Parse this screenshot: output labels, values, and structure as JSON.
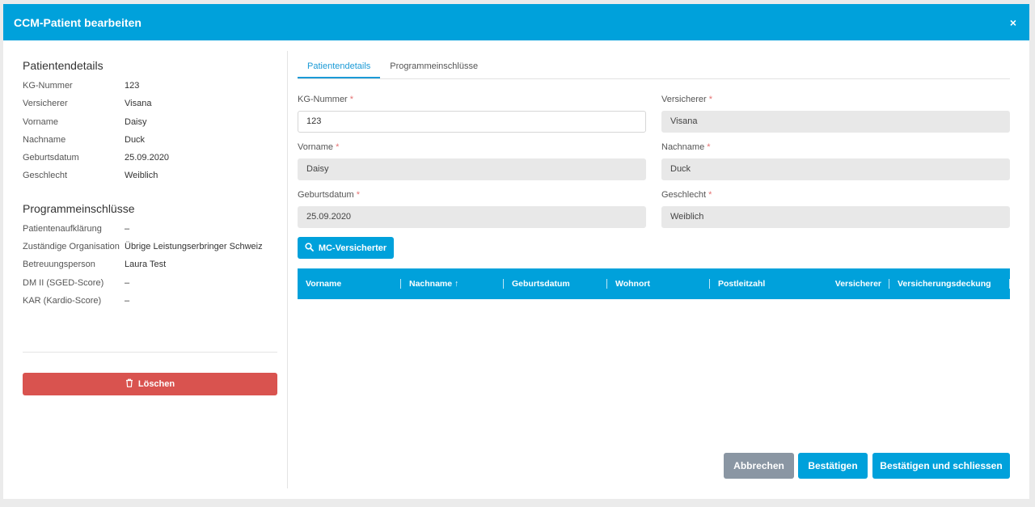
{
  "dialog": {
    "title": "CCM-Patient bearbeiten",
    "close_glyph": "×"
  },
  "patient_details": {
    "title": "Patientendetails",
    "rows": [
      {
        "key": "KG-Nummer",
        "value": "123"
      },
      {
        "key": "Versicherer",
        "value": "Visana"
      },
      {
        "key": "Vorname",
        "value": "Daisy"
      },
      {
        "key": "Nachname",
        "value": "Duck"
      },
      {
        "key": "Geburtsdatum",
        "value": "25.09.2020"
      },
      {
        "key": "Geschlecht",
        "value": "Weiblich"
      }
    ]
  },
  "program_inclusions": {
    "title": "Programmeinschlüsse",
    "rows": [
      {
        "key": "Patientenaufklärung",
        "value": "–"
      },
      {
        "key": "Zuständige Organisation",
        "value": "Übrige Leistungserbringer Schweiz"
      },
      {
        "key": "Betreuungsperson",
        "value": "Laura Test"
      },
      {
        "key": "DM II (SGED-Score)",
        "value": "–"
      },
      {
        "key": "KAR (Kardio-Score)",
        "value": "–"
      }
    ]
  },
  "delete_button": {
    "label": "Löschen",
    "icon": "trash-icon",
    "color": "#d9534f"
  },
  "tabs": [
    {
      "label": "Patientendetails",
      "active": true
    },
    {
      "label": "Programmeinschlüsse",
      "active": false
    }
  ],
  "form": {
    "required_marker": "*",
    "kg_nummer": {
      "label": "KG-Nummer",
      "value": "123"
    },
    "versicherer": {
      "label": "Versicherer",
      "value": "Visana"
    },
    "vorname": {
      "label": "Vorname",
      "value": "Daisy"
    },
    "nachname": {
      "label": "Nachname",
      "value": "Duck"
    },
    "geburtsdatum": {
      "label": "Geburtsdatum",
      "value": "25.09.2020"
    },
    "geschlecht": {
      "label": "Geschlecht",
      "value": "Weiblich"
    }
  },
  "search_button": {
    "label": "MC-Versicherter",
    "icon": "search-icon"
  },
  "grid": {
    "columns": [
      "Vorname",
      "Nachname",
      "Geburtsdatum",
      "Wohnort",
      "Postleitzahl",
      "Versicherer",
      "Versicherungsdeckung"
    ],
    "sort_indicator": "↑",
    "header_color": "#00a1db"
  },
  "footer": {
    "cancel_label": "Abbrechen",
    "confirm_label": "Bestätigen",
    "confirm_close_label": "Bestätigen und schliessen"
  },
  "colors": {
    "accent": "#00a1db",
    "cancel": "#8a96a3",
    "danger": "#d9534f"
  }
}
